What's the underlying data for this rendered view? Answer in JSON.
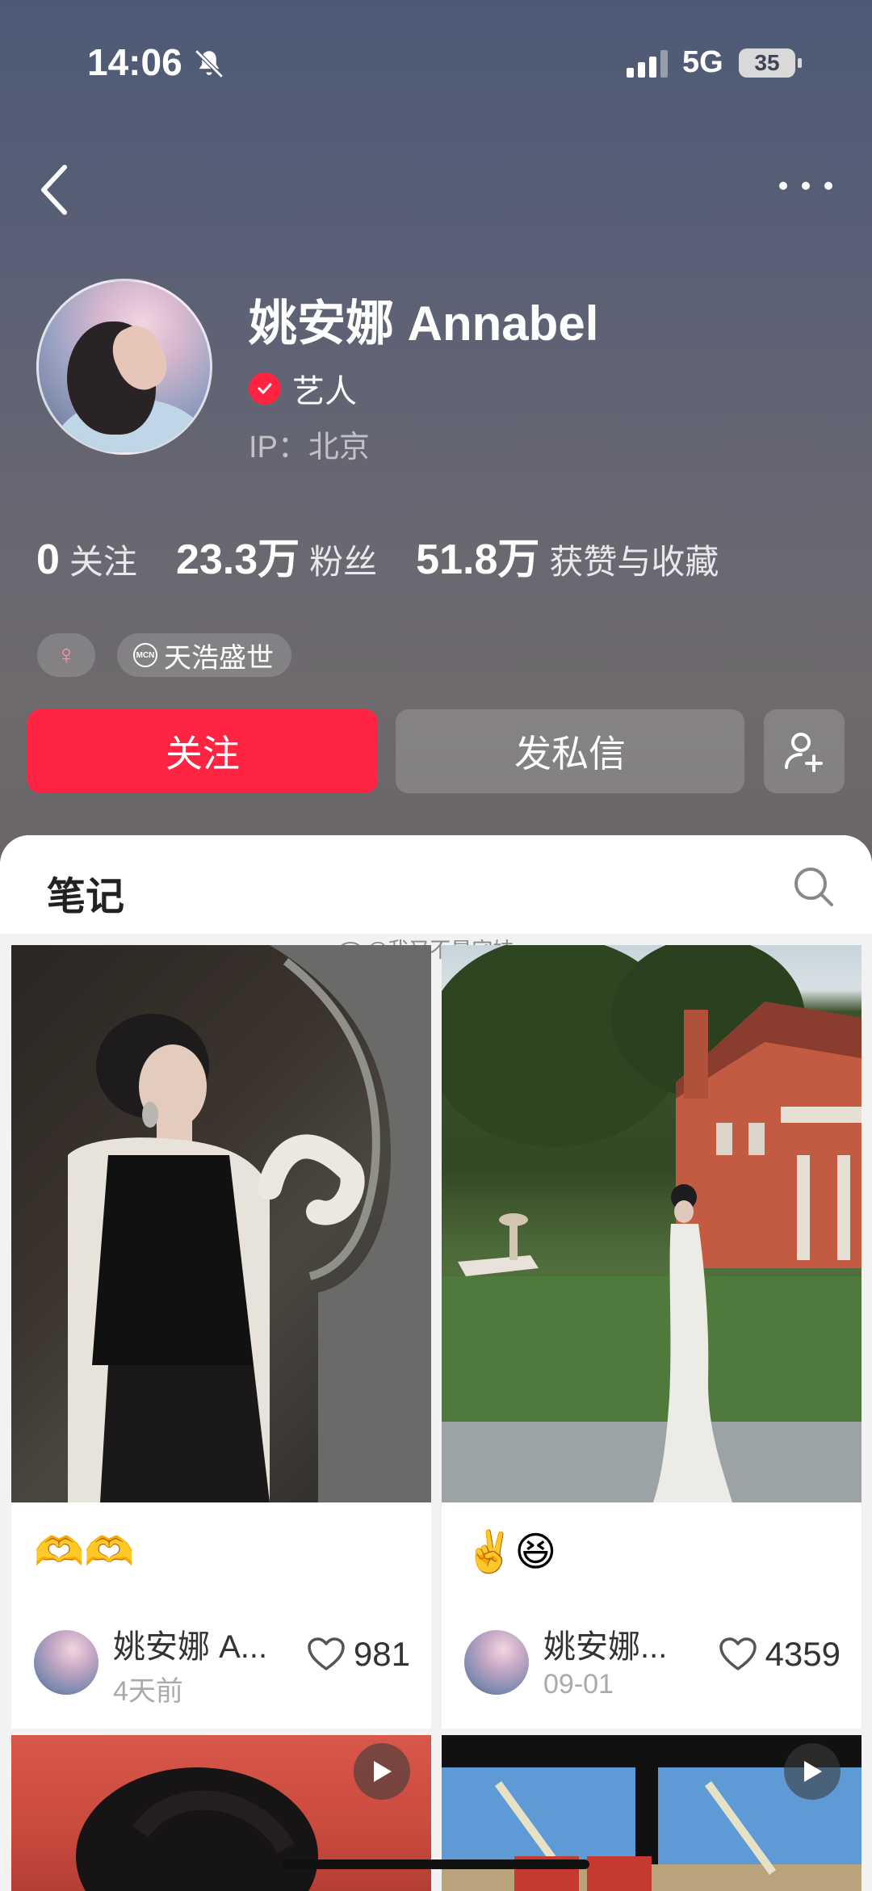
{
  "status_bar": {
    "time": "14:06",
    "network": "5G",
    "battery": "35"
  },
  "profile": {
    "name": "姚安娜 Annabel",
    "verified_label": "艺人",
    "ip_location": "IP：北京",
    "stats": [
      {
        "value": "0",
        "label": "关注"
      },
      {
        "value": "23.3万",
        "label": "粉丝"
      },
      {
        "value": "51.8万",
        "label": "获赞与收藏"
      }
    ],
    "tags": {
      "gender": "♀",
      "mcn_icon": "MCN",
      "mcn": "天浩盛世"
    }
  },
  "actions": {
    "follow": "关注",
    "message": "发私信"
  },
  "tabs": {
    "notes": "笔记"
  },
  "watermark": "@我又不是宅妹",
  "posts": [
    {
      "title": "🫶🫶",
      "author": "姚安娜 A...",
      "time": "4天前",
      "likes": "981"
    },
    {
      "title": "✌️😆",
      "author": "姚安娜...",
      "time": "09-01",
      "likes": "4359"
    }
  ],
  "icons": {
    "back": "chevron-left-icon",
    "more": "more-dots-icon",
    "search": "search-icon",
    "add_user": "add-user-icon",
    "like": "heart-icon",
    "play": "play-icon"
  },
  "colors": {
    "accent": "#ff2442"
  }
}
